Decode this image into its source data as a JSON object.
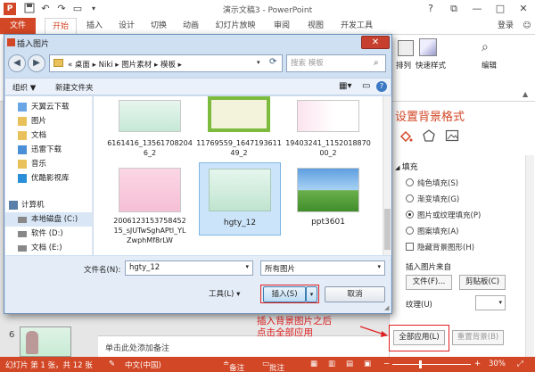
{
  "app": {
    "title": "演示文稿3 - PowerPoint",
    "login_label": "登录",
    "colors": {
      "accent": "#d24726",
      "dialog": "#cfe0f3"
    }
  },
  "quick_access": [
    "save-icon",
    "undo-icon",
    "redo-icon",
    "start-slideshow-icon",
    "customize-icon"
  ],
  "window_controls": [
    "?",
    "⧉",
    "—",
    "□",
    "✕"
  ],
  "ribbon_tabs": [
    "文件",
    "开始",
    "插入",
    "设计",
    "切换",
    "动画",
    "幻灯片放映",
    "审阅",
    "视图",
    "开发工具"
  ],
  "ribbon": {
    "arrange_label": "排列",
    "quick_styles_label": "快速样式",
    "edit_label": "编辑"
  },
  "format_pane": {
    "title": "设置背景格式",
    "fill_header": "填充",
    "options": [
      "纯色填充(S)",
      "渐变填充(G)",
      "图片或纹理填充(P)",
      "图案填充(A)"
    ],
    "selected_option_index": 2,
    "hide_bg_label": "隐藏背景图形(H)",
    "insert_from_label": "插入图片来自",
    "file_button": "文件(F)...",
    "clipboard_button": "剪贴板(C)",
    "texture_label": "纹理(U)",
    "apply_all_button": "全部应用(L)",
    "reset_button": "重置背景(B)"
  },
  "workspace": {
    "slide_number": "6",
    "notes_placeholder": "单击此处添加备注"
  },
  "annotation": {
    "line1": "插入背景图片之后",
    "line2": "点击全部应用"
  },
  "dialog": {
    "title": "插入图片",
    "close_label": "✕",
    "breadcrumb": [
      "桌面",
      "Niki",
      "图片素材",
      "模板"
    ],
    "search_placeholder": "搜索 模板",
    "toolbar": {
      "organize": "组织 ▼",
      "new_folder": "新建文件夹"
    },
    "nav_items": [
      {
        "label": "天翼云下载",
        "icon": "cloud-folder-icon"
      },
      {
        "label": "图片",
        "icon": "pictures-folder-icon"
      },
      {
        "label": "文档",
        "icon": "documents-folder-icon"
      },
      {
        "label": "迅雷下载",
        "icon": "thunder-folder-icon"
      },
      {
        "label": "音乐",
        "icon": "music-folder-icon"
      },
      {
        "label": "优酷影视库",
        "icon": "youku-folder-icon"
      },
      {
        "label": "计算机",
        "icon": "computer-icon"
      },
      {
        "label": "本地磁盘 (C:)",
        "icon": "drive-icon"
      },
      {
        "label": "软件 (D:)",
        "icon": "drive-icon"
      },
      {
        "label": "文档 (E:)",
        "icon": "drive-icon"
      }
    ],
    "files": [
      {
        "name": "6161416_135617082046_2"
      },
      {
        "name": "11769559_164719361149_2"
      },
      {
        "name": "19403241_115201887000_2"
      },
      {
        "name": "200612315375845215_sJUTwSghAPtl_YLZwphMf8rLW"
      },
      {
        "name": "hgty_12"
      },
      {
        "name": "ppt3601"
      }
    ],
    "selected_file_index": 4,
    "filename_label": "文件名(N):",
    "filename_value": "hgty_12",
    "filetype_value": "所有图片",
    "tools_label": "工具(L)",
    "insert_label": "插入(S)",
    "cancel_label": "取消"
  },
  "statusbar": {
    "slide_info": "幻灯片 第 1 张，共 12 张",
    "language": "中文(中国)",
    "notes_label": "备注",
    "comments_label": "批注",
    "zoom": "30%"
  }
}
